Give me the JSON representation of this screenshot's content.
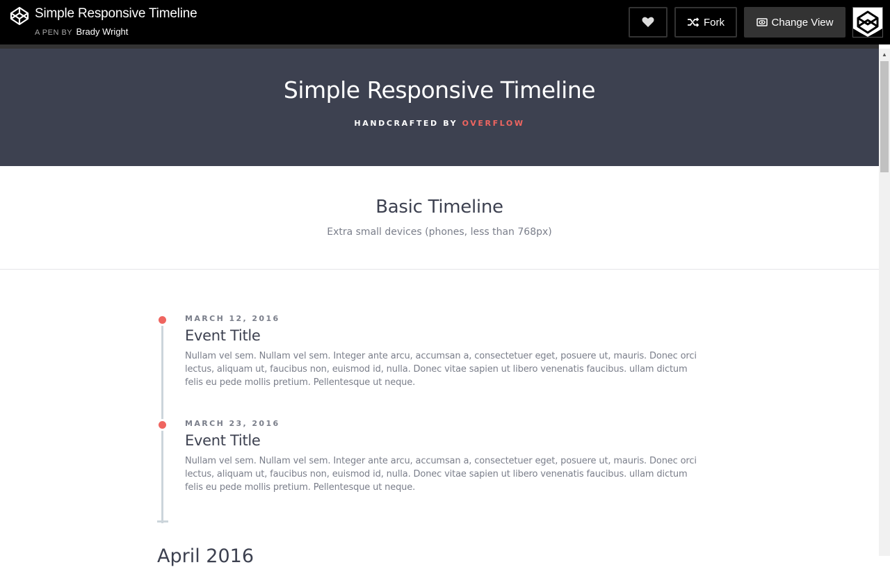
{
  "topbar": {
    "pen_title": "Simple Responsive Timeline",
    "pen_by_prefix": "A PEN BY",
    "author": "Brady Wright",
    "fork_label": "Fork",
    "change_view_label": "Change View"
  },
  "hero": {
    "title": "Simple Responsive Timeline",
    "subtitle_prefix": "HANDCRAFTED BY",
    "subtitle_accent": "OVERFLOW"
  },
  "section": {
    "title": "Basic Timeline",
    "subtitle": "Extra small devices (phones, less than 768px)"
  },
  "timeline": {
    "items": [
      {
        "date": "MARCH 12, 2016",
        "title": "Event Title",
        "body": "Nullam vel sem. Nullam vel sem. Integer ante arcu, accumsan a, consectetuer eget, posuere ut, mauris. Donec orci lectus, aliquam ut, faucibus non, euismod id, nulla. Donec vitae sapien ut libero venenatis faucibus. ullam dictum felis eu pede mollis pretium. Pellentesque ut neque."
      },
      {
        "date": "MARCH 23, 2016",
        "title": "Event Title",
        "body": "Nullam vel sem. Nullam vel sem. Integer ante arcu, accumsan a, consectetuer eget, posuere ut, mauris. Donec orci lectus, aliquam ut, faucibus non, euismod id, nulla. Donec vitae sapien ut libero venenatis faucibus. ullam dictum felis eu pede mollis pretium. Pellentesque ut neque."
      }
    ],
    "next_month": "April 2016"
  },
  "colors": {
    "accent": "#ef6560",
    "hero_bg": "#3d4150",
    "topbar_bg": "#000000"
  },
  "icons": [
    "codepen-logo-icon",
    "heart-icon",
    "fork-icon",
    "eye-icon",
    "codepen-avatar-icon"
  ]
}
